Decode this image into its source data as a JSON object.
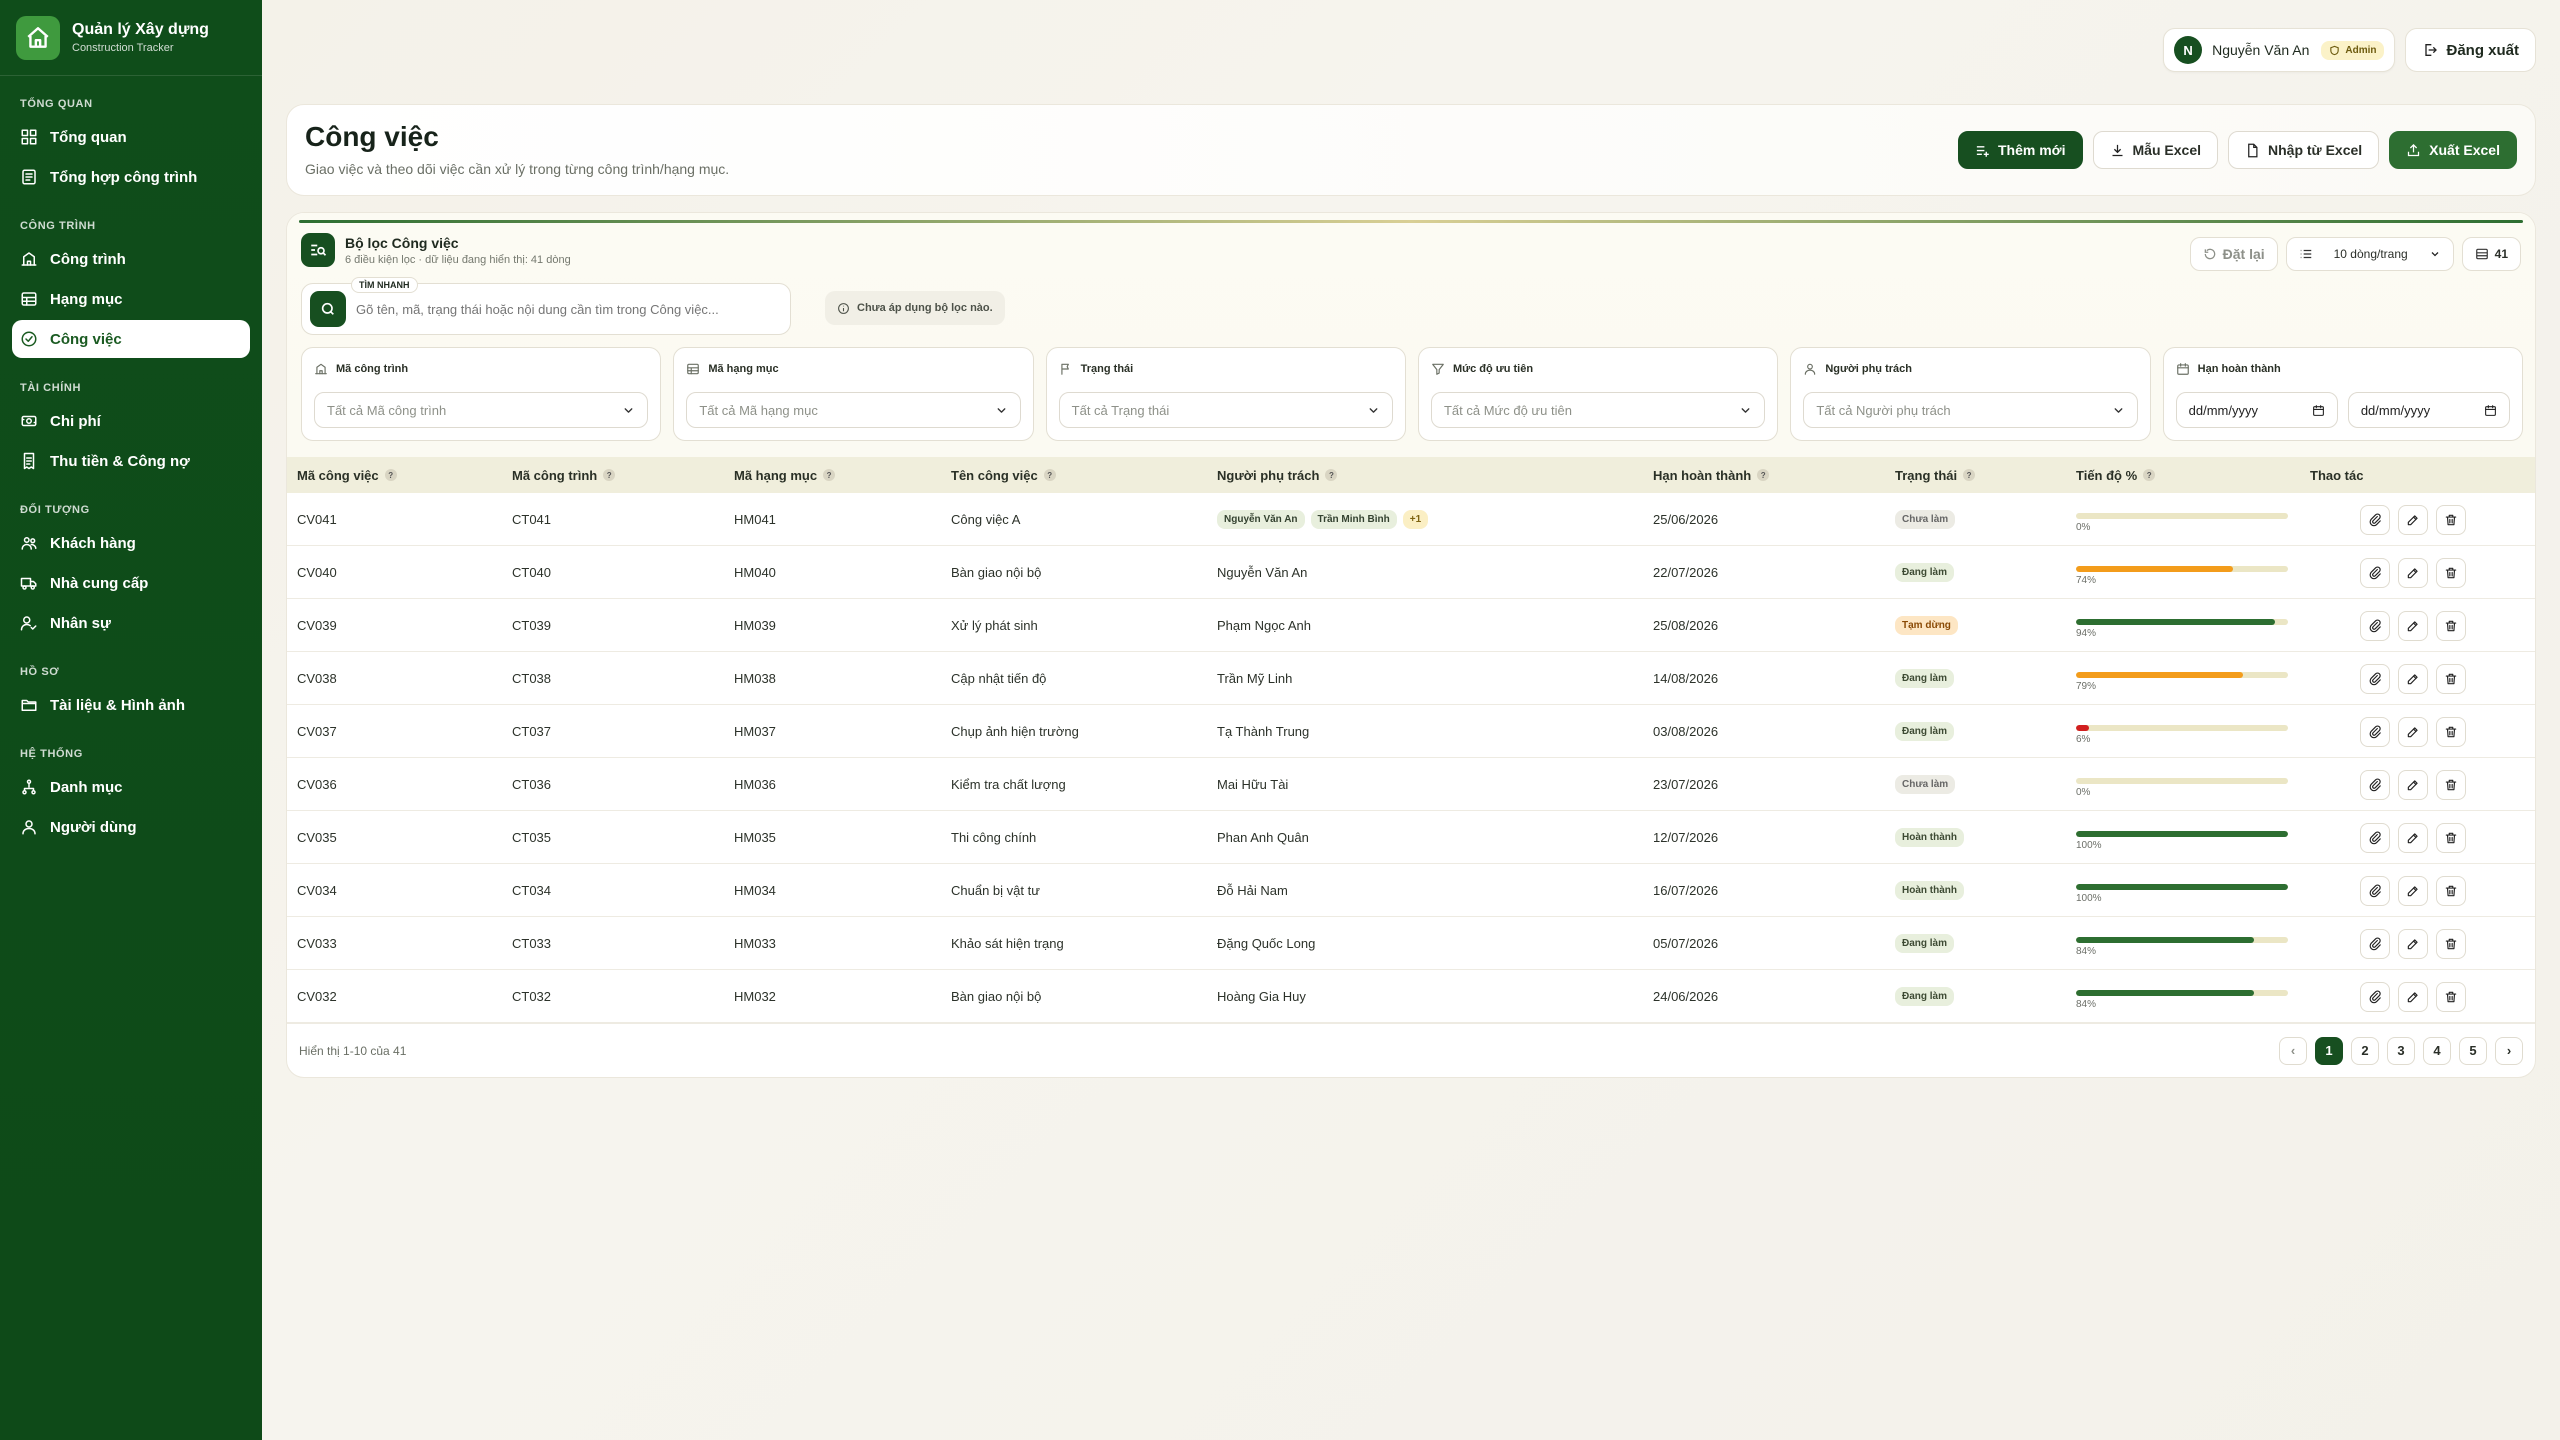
{
  "brand": {
    "title": "Quản lý Xây dựng",
    "subtitle": "Construction Tracker"
  },
  "sidebar": {
    "sections": [
      {
        "title": "TỔNG QUAN",
        "items": [
          {
            "label": "Tổng quan",
            "icon": "dashboard-icon"
          },
          {
            "label": "Tổng hợp công trình",
            "icon": "report-icon"
          }
        ]
      },
      {
        "title": "CÔNG TRÌNH",
        "items": [
          {
            "label": "Công trình",
            "icon": "building-icon"
          },
          {
            "label": "Hạng mục",
            "icon": "table-icon"
          },
          {
            "label": "Công việc",
            "icon": "check-circle-icon",
            "active": true
          }
        ]
      },
      {
        "title": "TÀI CHÍNH",
        "items": [
          {
            "label": "Chi phí",
            "icon": "money-icon"
          },
          {
            "label": "Thu tiền & Công nợ",
            "icon": "receipt-icon"
          }
        ]
      },
      {
        "title": "ĐỐI TƯỢNG",
        "items": [
          {
            "label": "Khách hàng",
            "icon": "users-icon"
          },
          {
            "label": "Nhà cung cấp",
            "icon": "truck-icon"
          },
          {
            "label": "Nhân sự",
            "icon": "user-check-icon"
          }
        ]
      },
      {
        "title": "HỒ SƠ",
        "items": [
          {
            "label": "Tài liệu & Hình ảnh",
            "icon": "folder-icon"
          }
        ]
      },
      {
        "title": "HỆ THỐNG",
        "items": [
          {
            "label": "Danh mục",
            "icon": "tree-icon"
          },
          {
            "label": "Người dùng",
            "icon": "user-icon"
          }
        ]
      }
    ]
  },
  "topbar": {
    "avatar_initial": "N",
    "user_name": "Nguyễn Văn An",
    "role": "Admin",
    "logout_label": "Đăng xuất"
  },
  "header": {
    "title": "Công việc",
    "subtitle": "Giao việc và theo dõi việc cần xử lý trong từng công trình/hạng mục.",
    "actions": {
      "add": "Thêm mới",
      "template": "Mẫu Excel",
      "import": "Nhập từ Excel",
      "export": "Xuất Excel"
    }
  },
  "filter": {
    "title": "Bộ lọc Công việc",
    "subtitle": "6 điều kiện lọc · dữ liệu đang hiển thị: 41 dòng",
    "reset_label": "Đặt lại",
    "page_size": "10 dòng/trang",
    "count": "41",
    "search_tag": "TÌM NHANH",
    "search_placeholder": "Gõ tên, mã, trạng thái hoặc nội dung cần tìm trong Công việc...",
    "status_text": "Chưa áp dụng bộ lọc nào.",
    "fields": [
      {
        "label": "Mã công trình",
        "value": "Tất cả Mã công trình",
        "icon": "building-icon"
      },
      {
        "label": "Mã hạng mục",
        "value": "Tất cả Mã hạng mục",
        "icon": "table-icon"
      },
      {
        "label": "Trạng thái",
        "value": "Tất cả Trạng thái",
        "icon": "flag-icon"
      },
      {
        "label": "Mức độ ưu tiên",
        "value": "Tất cả Mức độ ưu tiên",
        "icon": "filter-icon"
      },
      {
        "label": "Người phụ trách",
        "value": "Tất cả Người phụ trách",
        "icon": "user-icon"
      }
    ],
    "date_field": {
      "label": "Hạn hoàn thành",
      "from": "dd/mm/yyyy",
      "to": "dd/mm/yyyy"
    }
  },
  "table": {
    "columns": [
      "Mã công việc",
      "Mã công trình",
      "Mã hạng mục",
      "Tên công việc",
      "Người phụ trách",
      "Hạn hoàn thành",
      "Trạng thái",
      "Tiến độ %",
      "Thao tác"
    ],
    "rows": [
      {
        "id": "CV041",
        "project": "CT041",
        "item": "HM041",
        "name": "Công việc A",
        "people": [
          "Nguyễn Văn An",
          "Trần Minh Bình",
          "+1"
        ],
        "due": "25/06/2026",
        "status": "Chưa làm",
        "progress": 0,
        "pct": "0%"
      },
      {
        "id": "CV040",
        "project": "CT040",
        "item": "HM040",
        "name": "Bàn giao nội bộ",
        "owner": "Nguyễn Văn An",
        "due": "22/07/2026",
        "status": "Đang làm",
        "progress": 74,
        "pct": "74%"
      },
      {
        "id": "CV039",
        "project": "CT039",
        "item": "HM039",
        "name": "Xử lý phát sinh",
        "owner": "Phạm Ngọc Anh",
        "due": "25/08/2026",
        "status": "Tạm dừng",
        "progress": 94,
        "pct": "94%"
      },
      {
        "id": "CV038",
        "project": "CT038",
        "item": "HM038",
        "name": "Cập nhật tiến độ",
        "owner": "Trần Mỹ Linh",
        "due": "14/08/2026",
        "status": "Đang làm",
        "progress": 79,
        "pct": "79%"
      },
      {
        "id": "CV037",
        "project": "CT037",
        "item": "HM037",
        "name": "Chụp ảnh hiện trường",
        "owner": "Tạ Thành Trung",
        "due": "03/08/2026",
        "status": "Đang làm",
        "progress": 6,
        "pct": "6%"
      },
      {
        "id": "CV036",
        "project": "CT036",
        "item": "HM036",
        "name": "Kiểm tra chất lượng",
        "owner": "Mai Hữu Tài",
        "due": "23/07/2026",
        "status": "Chưa làm",
        "progress": 0,
        "pct": "0%"
      },
      {
        "id": "CV035",
        "project": "CT035",
        "item": "HM035",
        "name": "Thi công chính",
        "owner": "Phan Anh Quân",
        "due": "12/07/2026",
        "status": "Hoàn thành",
        "progress": 100,
        "pct": "100%"
      },
      {
        "id": "CV034",
        "project": "CT034",
        "item": "HM034",
        "name": "Chuẩn bị vật tư",
        "owner": "Đỗ Hải Nam",
        "due": "16/07/2026",
        "status": "Hoàn thành",
        "progress": 100,
        "pct": "100%"
      },
      {
        "id": "CV033",
        "project": "CT033",
        "item": "HM033",
        "name": "Khảo sát hiện trạng",
        "owner": "Đặng Quốc Long",
        "due": "05/07/2026",
        "status": "Đang làm",
        "progress": 84,
        "pct": "84%"
      },
      {
        "id": "CV032",
        "project": "CT032",
        "item": "HM032",
        "name": "Bàn giao nội bộ",
        "owner": "Hoàng Gia Huy",
        "due": "24/06/2026",
        "status": "Đang làm",
        "progress": 84,
        "pct": "84%"
      }
    ]
  },
  "footer": {
    "showing": "Hiển thị 1-10 của 41",
    "pages": [
      "1",
      "2",
      "3",
      "4",
      "5"
    ],
    "prev": "‹",
    "next": "›"
  },
  "colors": {
    "primary": "#174f20",
    "sidebar": "#0f4d1a",
    "progress_green": "#2d6e31",
    "progress_orange": "#f39c1b",
    "progress_red": "#d11f1f"
  }
}
